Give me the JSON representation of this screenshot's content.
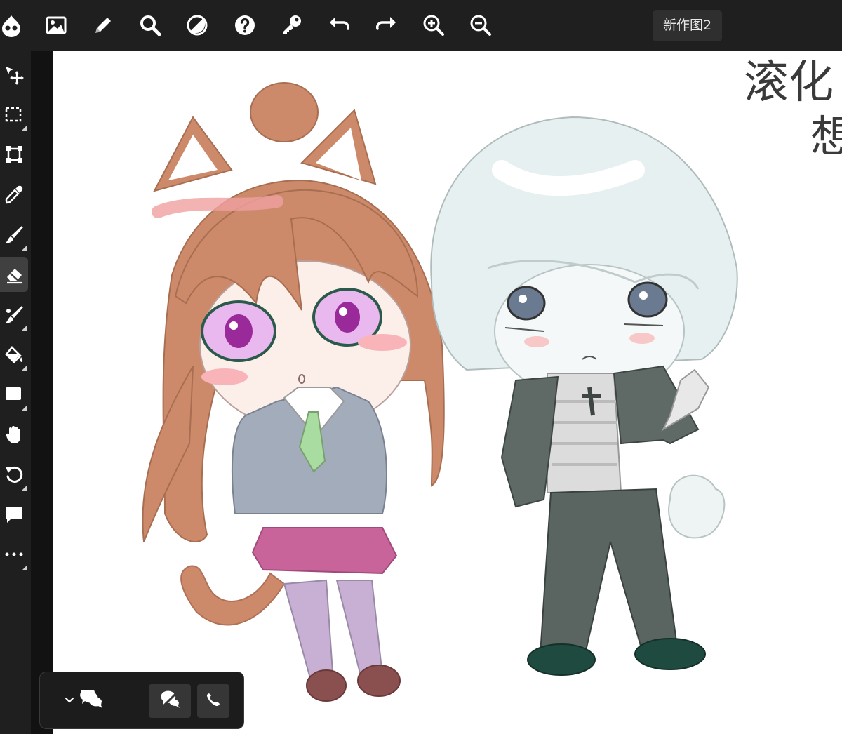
{
  "toolbar": {
    "document_title": "新作图2",
    "icons": [
      "app-logo-icon",
      "image-icon",
      "pencil-icon",
      "search-icon",
      "contrast-icon",
      "help-icon",
      "key-icon",
      "undo-icon",
      "redo-icon",
      "zoom-in-icon",
      "zoom-out-icon"
    ]
  },
  "sidebar": {
    "tools": [
      "move-tool-icon",
      "marquee-select-icon",
      "transform-icon",
      "eyedropper-icon",
      "brush-icon",
      "eraser-icon",
      "smudge-brush-icon",
      "fill-bucket-icon",
      "rectangle-shape-icon",
      "hand-pan-icon",
      "rotate-icon",
      "comment-icon",
      "more-tools-icon"
    ],
    "active_tool": "eraser-icon"
  },
  "canvas": {
    "handwriting_line1": "滚化",
    "handwriting_line2": "想"
  },
  "chat": {
    "icons": [
      "chevron-down-icon",
      "chat-bubbles-icon",
      "chat-off-icon",
      "phone-icon"
    ]
  },
  "colors": {
    "ui_bg": "#1f1f1f",
    "canvas_bg": "#ffffff",
    "icon": "#ffffff",
    "active_tool_bg": "#404040"
  }
}
